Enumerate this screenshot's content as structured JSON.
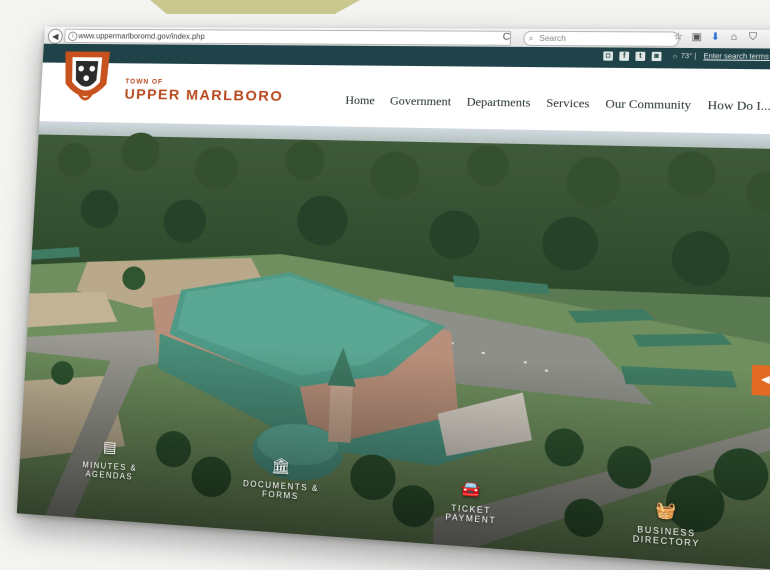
{
  "browser": {
    "url": "www.uppermarlboromd.gov/index.php",
    "search_placeholder": "Search",
    "back_glyph": "◀",
    "reload_glyph": "C",
    "icons": [
      "star-icon",
      "clipboard-icon",
      "download-icon",
      "home-icon",
      "shield-icon"
    ]
  },
  "topbar": {
    "weather": "☼ 73° |",
    "search_link": "Enter search terms",
    "search_glyph": "Q"
  },
  "header": {
    "town_of": "TOWN OF",
    "town_name": "UPPER MARLBORO",
    "brand_color": "#b8491f",
    "strip_color": "#1f4348"
  },
  "nav": {
    "items": [
      "Home",
      "Government",
      "Departments",
      "Services",
      "Our Community",
      "How Do I..."
    ]
  },
  "hero": {
    "tab_glyph": "◀",
    "tab_color": "#e36a23"
  },
  "quick_links": [
    {
      "icon": "document-icon",
      "glyph": "▤",
      "line1": "MINUTES &",
      "line2": "AGENDAS"
    },
    {
      "icon": "building-icon",
      "glyph": "🏛",
      "line1": "DOCUMENTS &",
      "line2": "FORMS"
    },
    {
      "icon": "car-icon",
      "glyph": "🚘",
      "line1": "TICKET",
      "line2": "PAYMENT"
    },
    {
      "icon": "basket-icon",
      "glyph": "🧺",
      "line1": "BUSINESS",
      "line2": "DIRECTORY"
    }
  ]
}
